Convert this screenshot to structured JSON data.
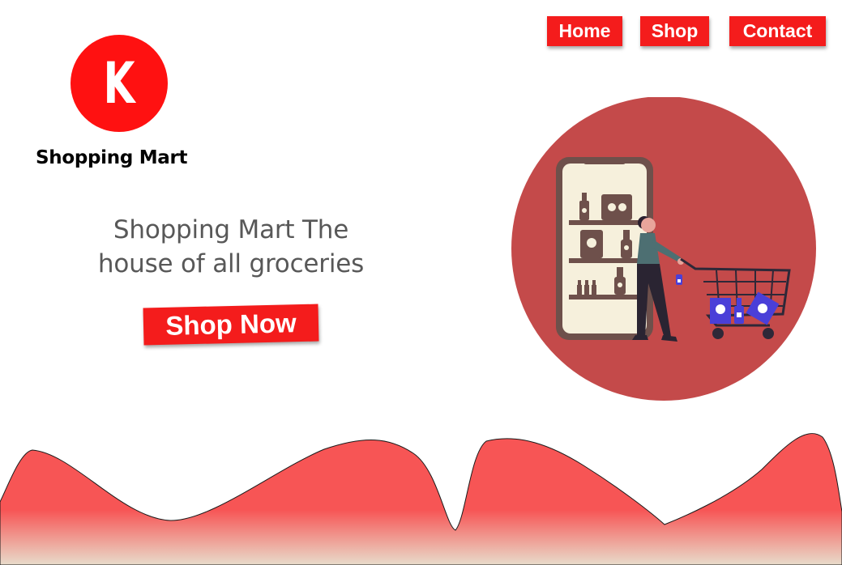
{
  "nav": {
    "home": "Home",
    "shop": "Shop",
    "contact": "Contact"
  },
  "logo": {
    "letter": "K",
    "brand_name": "Shopping Mart"
  },
  "hero": {
    "title_line1": "Shopping Mart The",
    "title_line2": "house of all groceries",
    "cta_label": "Shop Now"
  },
  "illustration": {
    "icon": "shopper-with-cart-icon"
  },
  "colors": {
    "accent": "#f41c1c",
    "logo_red": "#ff1111",
    "circle_bg": "#c44a4a",
    "wave_red": "#f75555",
    "wave_fade": "#e8dccb",
    "cart_blue": "#4a3fd8",
    "text_gray": "#585858"
  }
}
